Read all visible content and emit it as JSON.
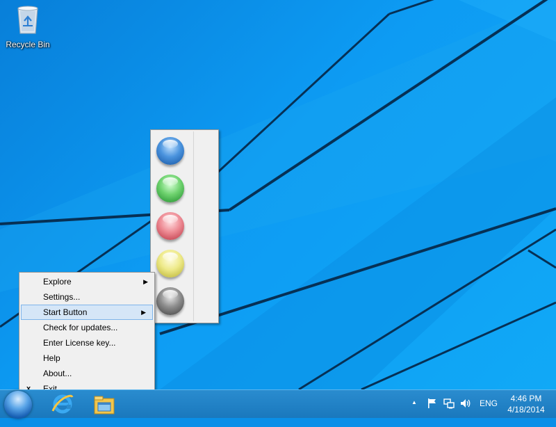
{
  "desktop": {
    "icons": [
      {
        "label": "Recycle Bin",
        "icon": "recycle-bin-icon"
      }
    ]
  },
  "context_menu": {
    "items": [
      {
        "label": "Explore",
        "has_submenu": true
      },
      {
        "label": "Settings...",
        "has_submenu": false
      },
      {
        "label": "Start Button",
        "has_submenu": true,
        "highlighted": true
      },
      {
        "label": "Check for updates...",
        "has_submenu": false
      },
      {
        "label": "Enter License key...",
        "has_submenu": false
      },
      {
        "label": "Help",
        "has_submenu": false
      },
      {
        "label": "About...",
        "has_submenu": false
      },
      {
        "label": "Exit",
        "has_submenu": false,
        "mark": "x"
      }
    ],
    "submenu_arrow": "▶"
  },
  "start_button_submenu": {
    "orbs": [
      {
        "name": "blue-orb",
        "color": "#2a78d0"
      },
      {
        "name": "green-orb",
        "color": "#3fbf4a"
      },
      {
        "name": "red-orb",
        "color": "#e0646f"
      },
      {
        "name": "yellow-orb",
        "color": "#e6e46a"
      },
      {
        "name": "gray-orb",
        "color": "#6a6a6a"
      }
    ]
  },
  "taskbar": {
    "pinned": [
      "internet-explorer-icon",
      "file-explorer-icon"
    ],
    "tray": {
      "show_hidden": "▲",
      "icons": [
        "action-center-flag-icon",
        "network-icon",
        "volume-icon"
      ],
      "language": "ENG",
      "time": "4:46 PM",
      "date": "4/18/2014"
    }
  },
  "colors": {
    "desktop_bg": "#0d9bf3",
    "taskbar_bg": "#1f80c6",
    "menu_bg": "#f0f0f0",
    "menu_highlight": "#d5e6f7"
  }
}
